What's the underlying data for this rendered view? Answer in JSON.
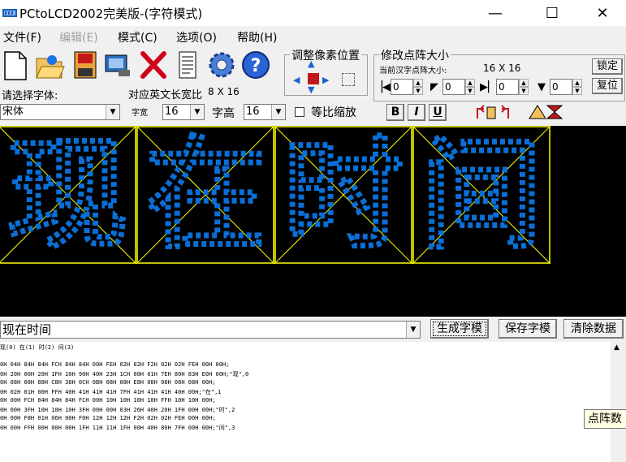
{
  "window": {
    "title": "PCtoLCD2002完美版-(字符模式)",
    "minimize": "—",
    "maximize": "☐",
    "close": "✕"
  },
  "menu": [
    {
      "label": "文件(F)",
      "enabled": true
    },
    {
      "label": "编辑(E)",
      "enabled": false
    },
    {
      "label": "模式(C)",
      "enabled": true
    },
    {
      "label": "选项(O)",
      "enabled": true
    },
    {
      "label": "帮助(H)",
      "enabled": true
    }
  ],
  "toolbar": {
    "icons": [
      "new-file-icon",
      "open-folder-icon",
      "save-disk-icon",
      "export-image-icon",
      "delete-x-icon",
      "notepad-icon",
      "settings-gear-icon",
      "help-question-icon"
    ],
    "font_label": "请选择字体:",
    "font_value": "宋体",
    "ratio_label": "对应英文长宽比",
    "ratio_value": "8 X 16",
    "width_label": "字宽",
    "width_value": "16",
    "height_label": "字高",
    "height_value": "16",
    "proportional_label": "等比缩放",
    "bold": "B",
    "italic": "I",
    "underline": "U"
  },
  "pixel_pos": {
    "title": "调整像素位置"
  },
  "matrix_size": {
    "title": "修改点阵大小",
    "current_label": "当前汉字点阵大小:",
    "current_value": "16 X 16",
    "lock_button": "锁定",
    "reset_button": "复位",
    "spin_values": [
      "0",
      "0",
      "0",
      "0"
    ]
  },
  "preview": {
    "characters": [
      "现",
      "在",
      "时",
      "间"
    ]
  },
  "bottom": {
    "input_value": "现在时间",
    "generate_button": "生成字模",
    "save_button": "保存字模",
    "clear_button": "清除数据",
    "tooltip": "点阵数"
  },
  "output": {
    "lines": [
      " 现(0) 在(1) 时(2) 间(3)",
      "",
      "0H 04H 84H 84H FCH 84H 84H 00H FEH 02H 02H F2H 02H 02H FEH 00H 00H;",
      "0H 20H 00H 20H 1FH 10H 90H 40H 23H 1CH 00H 01H 7EH 80H 83H E0H 00H;\"现\",0",
      "0H 08H 08H 88H C8H 38H 0CH 0BH 08H 08H E8H 08H 08H 08H 08H 00H;",
      "0H 02H 01H 00H FFH 40H 41H 41H 41H 7FH 41H 41H 41H 40H 00H;\"在\",1",
      "0H 00H FCH 84H 84H 84H FCH 00H 10H 10H 10H 10H FFH 10H 10H 00H;",
      "0H 00H 3FH 10H 10H 10H 3FH 00H 00H 03H 26H 40H 20H 1FH 00H 00H;\"时\",2",
      "0H 00H F8H 01H 06H 00H F0H 12H 12H 12H F2H 02H 02H FEH 00H 00H;",
      "0H 00H FFH 00H 00H 00H 1FH 11H 11H 1FH 00H 40H 80H 7FH 00H 00H;\"间\",3"
    ]
  },
  "colors": {
    "pixel": "#0a6fd6",
    "grid_line": "#ffff00",
    "canvas_bg": "#000000"
  }
}
